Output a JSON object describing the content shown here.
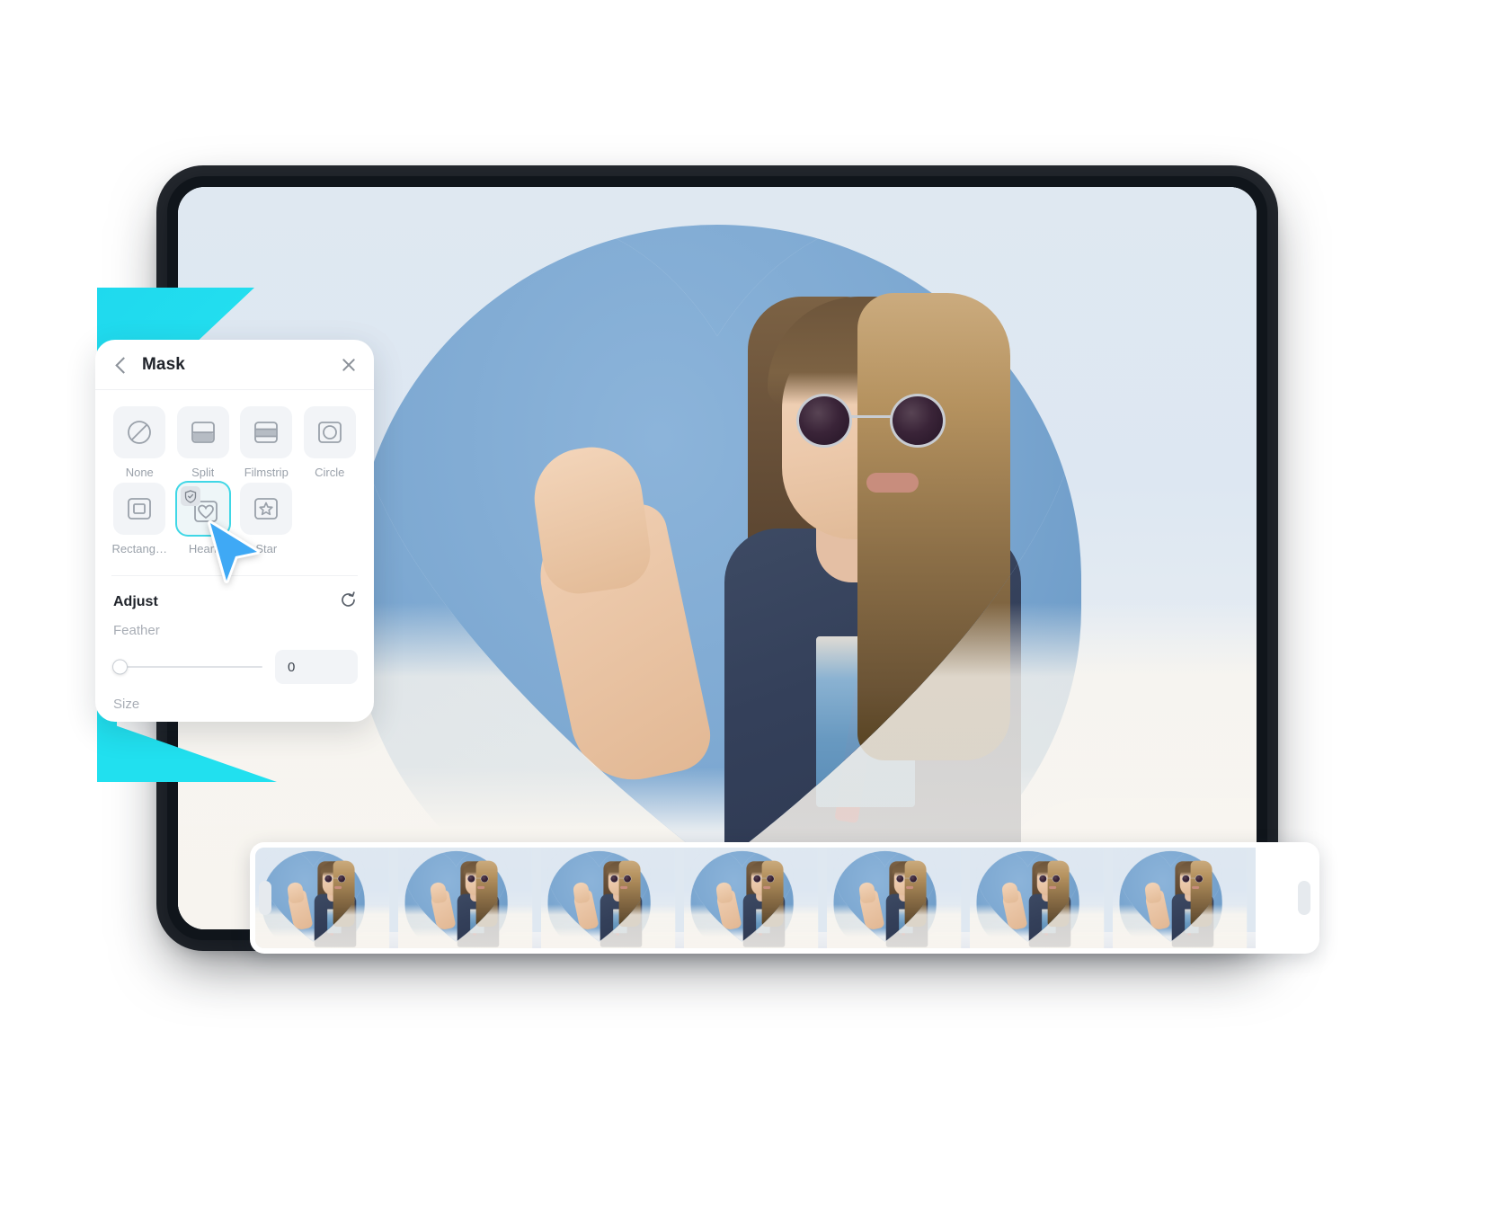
{
  "app": {
    "device": "tablet",
    "accent_color": "#21e0ef",
    "selection_color": "#3fd7e6"
  },
  "panel": {
    "title": "Mask",
    "back_icon": "chevron-left-icon",
    "close_icon": "close-icon",
    "masks": [
      {
        "label": "None",
        "icon": "no-mask-icon",
        "selected": false
      },
      {
        "label": "Split",
        "icon": "split-icon",
        "selected": false
      },
      {
        "label": "Filmstrip",
        "icon": "filmstrip-icon",
        "selected": false
      },
      {
        "label": "Circle",
        "icon": "circle-icon",
        "selected": false
      },
      {
        "label": "Rectang…",
        "icon": "rectangle-icon",
        "selected": false
      },
      {
        "label": "Heart",
        "icon": "heart-icon",
        "selected": true
      },
      {
        "label": "Star",
        "icon": "star-icon",
        "selected": false
      }
    ],
    "adjust": {
      "title": "Adjust",
      "reset_icon": "reset-icon",
      "feather": {
        "label": "Feather",
        "value": "0",
        "percent": 0
      },
      "size": {
        "label": "Size"
      }
    }
  },
  "filmstrip": {
    "thumb_count": 7,
    "left_handle": "trim-handle-left",
    "right_handle": "trim-handle-right"
  },
  "canvas": {
    "mask_shape": "heart",
    "photo_alt": "woman in sunglasses against blue backdrop"
  },
  "cursor": {
    "icon": "pointer-cursor"
  }
}
